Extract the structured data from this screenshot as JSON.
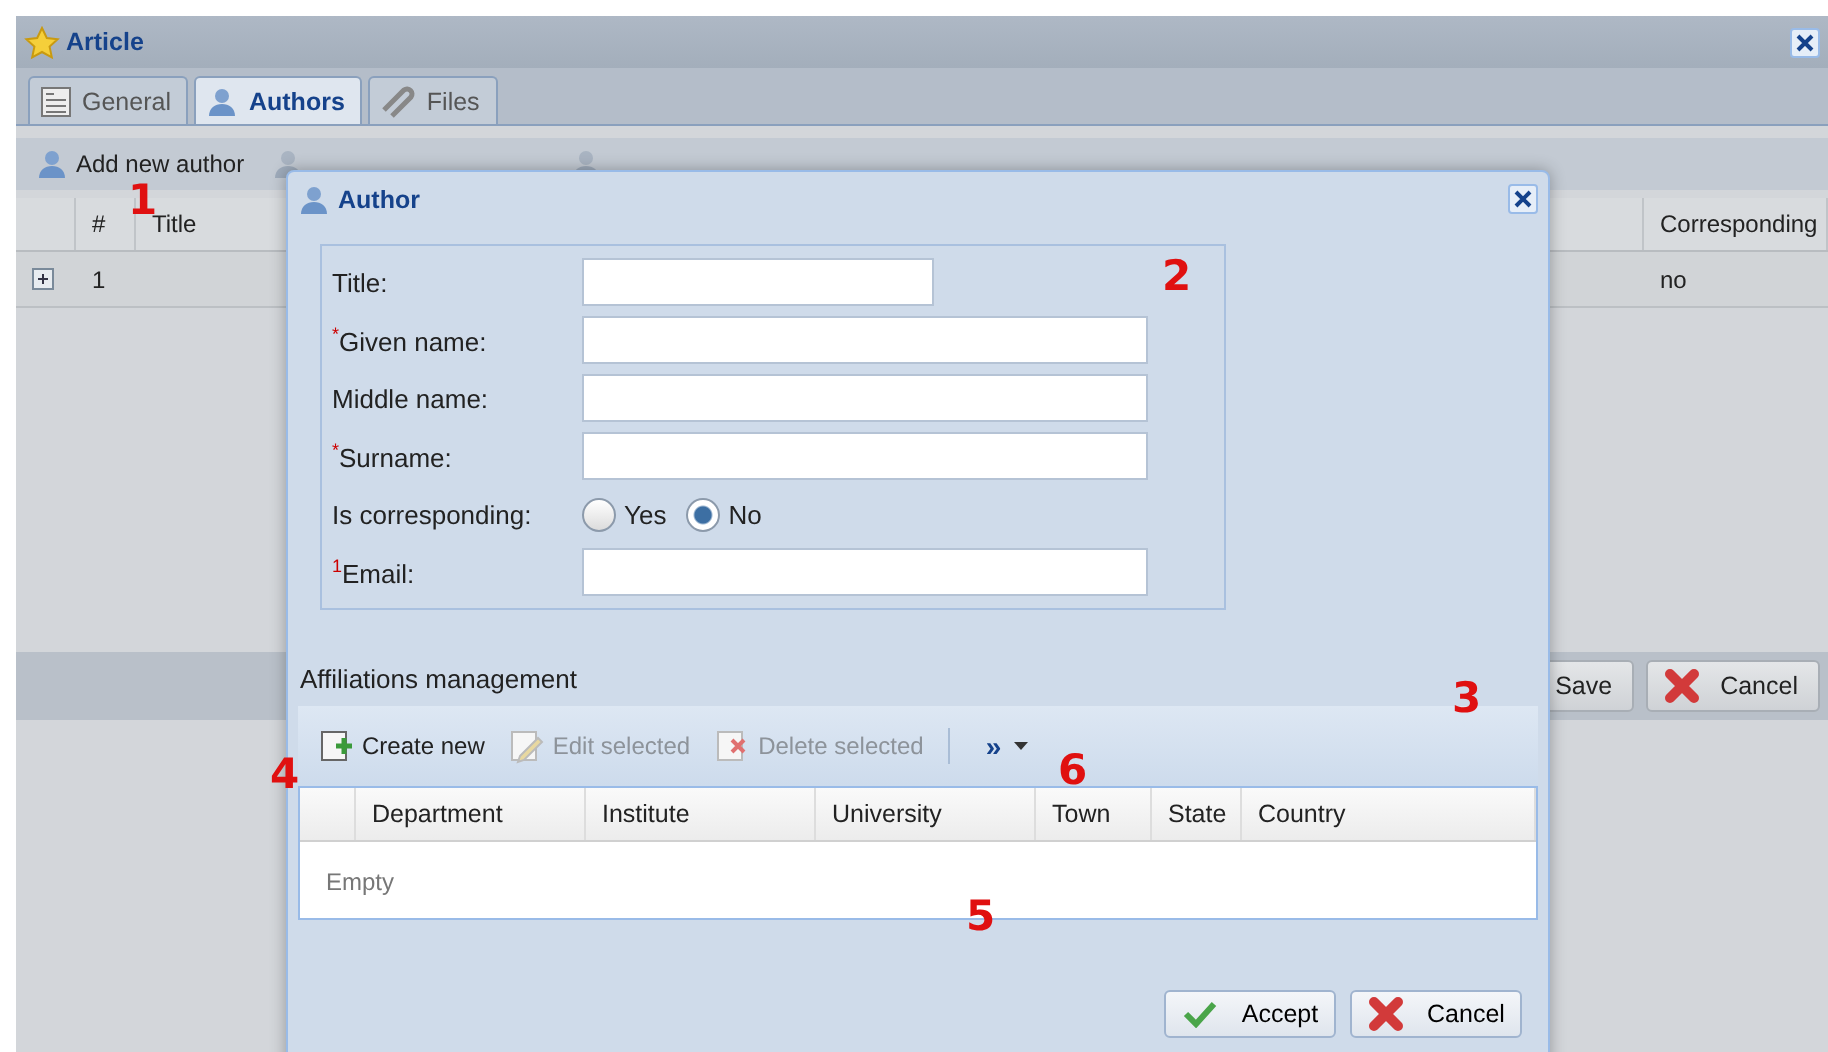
{
  "window": {
    "title": "Article"
  },
  "tabs": [
    {
      "label": "General",
      "selected": false,
      "kind": "form"
    },
    {
      "label": "Authors",
      "selected": true,
      "kind": "person"
    },
    {
      "label": "Files",
      "selected": false,
      "kind": "clip"
    }
  ],
  "toolbar": [
    {
      "label": "Add new author",
      "disabled": false
    },
    {
      "disabled": true
    },
    {
      "disabled": true
    }
  ],
  "authors_grid": {
    "columns": [
      "#",
      "Title",
      "Corresponding"
    ],
    "rows": [
      {
        "number": "1",
        "corresponding": "no",
        "expanded": false
      }
    ]
  },
  "footer_buttons": [
    {
      "label": "Save",
      "kind": "save"
    },
    {
      "label": "Cancel",
      "kind": "cancel"
    }
  ],
  "dialog": {
    "title": "Author",
    "fields": [
      {
        "label": "Title:",
        "kind": "short"
      },
      {
        "label": "$^{*}$Given name:",
        "kind": "text"
      },
      {
        "label": "Middle name:",
        "kind": "text"
      },
      {
        "label": "$^{*}$Surname:",
        "kind": "text"
      },
      {
        "label": "Is corresponding:",
        "kind": "radio",
        "options": [
          {
            "label": "Yes",
            "selected": false
          },
          {
            "label": "No",
            "selected": true
          }
        ]
      },
      {
        "label": "$^{1}$Email:",
        "kind": "text"
      }
    ],
    "affiliations": {
      "title": "Affiliations management",
      "toolbar": [
        {
          "label": "Create new",
          "disabled": false
        },
        {
          "label": "Edit selected",
          "disabled": true
        },
        {
          "label": "Delete selected",
          "disabled": true
        }
      ],
      "overflow": "»",
      "columns": [
        "Department",
        "Institute",
        "University",
        "Town",
        "State",
        "Country"
      ],
      "empty_text": "Empty"
    },
    "buttons": [
      {
        "label": "Accept",
        "kind": "accept"
      },
      {
        "label": "Cancel",
        "kind": "cancel"
      }
    ]
  },
  "annotations": [
    "1",
    "2",
    "3",
    "4",
    "5",
    "6"
  ]
}
